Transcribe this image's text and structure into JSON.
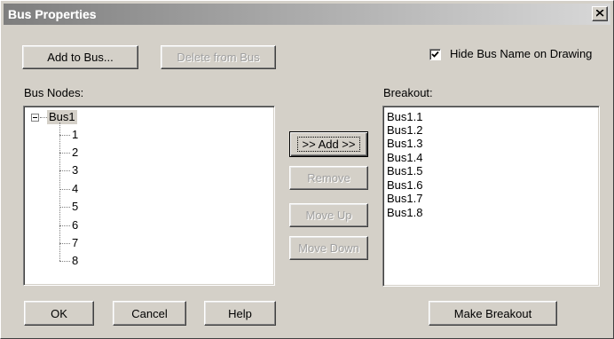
{
  "window": {
    "title": "Bus Properties"
  },
  "toolbar": {
    "add_to_bus": "Add to Bus...",
    "delete_from_bus": "Delete from Bus"
  },
  "hide_bus_name": {
    "label": "Hide Bus Name on Drawing",
    "checked": true
  },
  "bus_nodes": {
    "label": "Bus Nodes:",
    "root": "Bus1",
    "children": [
      "1",
      "2",
      "3",
      "4",
      "5",
      "6",
      "7",
      "8"
    ]
  },
  "middle": {
    "add": ">> Add >>",
    "remove": "Remove",
    "move_up": "Move Up",
    "move_down": "Move Down"
  },
  "breakout": {
    "label": "Breakout:",
    "items": [
      "Bus1.1",
      "Bus1.2",
      "Bus1.3",
      "Bus1.4",
      "Bus1.5",
      "Bus1.6",
      "Bus1.7",
      "Bus1.8"
    ]
  },
  "footer": {
    "ok": "OK",
    "cancel": "Cancel",
    "help": "Help",
    "make_breakout": "Make Breakout"
  }
}
